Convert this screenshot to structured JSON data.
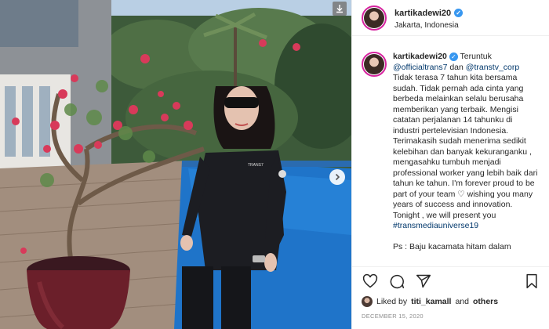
{
  "post": {
    "username": "kartikadewi20",
    "location": "Jakarta, Indonesia",
    "caption": {
      "username": "kartikadewi20",
      "intro": "Teruntuk",
      "mention1": "@officialtrans7",
      "conj": "dan",
      "mention2": "@transtv_corp",
      "paragraph1": "Tidak terasa 7 tahun kita bersama sudah. Tidak pernah ada cinta yang berbeda melainkan selalu berusaha memberikan yang terbaik. Mengisi catatan perjalanan 14 tahunku di industri pertelevisian Indonesia.",
      "paragraph2a": "Terimakasih sudah menerima sedikit kelebihan dan banyak kekuranganku , mengasahku tumbuh menjadi professional worker yang lebih baik dari tahun ke tahun. I'm forever proud to be part of your team",
      "paragraph2b": "wishing you many years of success and innovation.",
      "paragraph3": "Tonight , we will present you",
      "hashtag": "#transmediauniverse19",
      "cut_line": "Ps : Baju kacamata hitam dalam"
    },
    "liked_by_prefix": "Liked by",
    "liked_by_user": "titi_kamall",
    "liked_by_suffix": "and",
    "liked_by_others": "others",
    "date": "DECEMBER 15, 2020",
    "icons": {
      "like": "heart-icon",
      "comment": "comment-icon",
      "share": "share-icon",
      "save": "bookmark-icon",
      "verified": "verified-badge-icon",
      "carousel": "chevron-right-icon",
      "download": "download-icon"
    },
    "colors": {
      "link": "#00376b",
      "verified": "#3897f0",
      "date": "#8e8e8e"
    }
  }
}
